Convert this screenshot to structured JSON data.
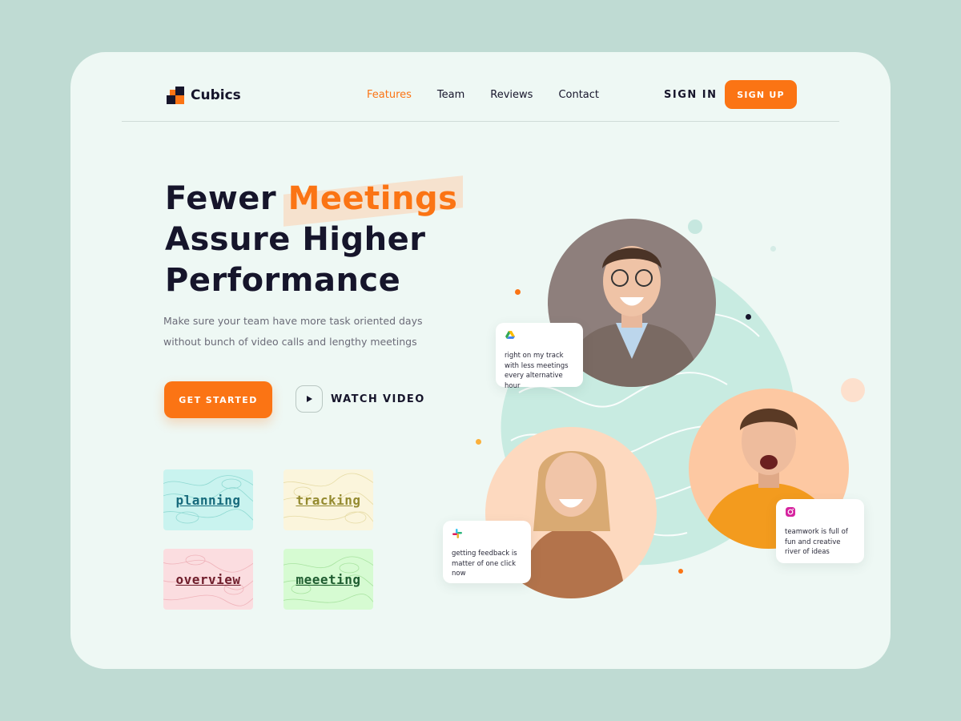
{
  "brand": {
    "name": "Cubics"
  },
  "nav": [
    {
      "label": "Features",
      "active": true
    },
    {
      "label": "Team",
      "active": false
    },
    {
      "label": "Reviews",
      "active": false
    },
    {
      "label": "Contact",
      "active": false
    }
  ],
  "auth": {
    "sign_in": "SIGN IN",
    "sign_up": "SIGN UP"
  },
  "hero": {
    "title_pre": "Fewer ",
    "title_highlight": "Meetings",
    "title_line2": "Assure Higher",
    "title_line3": "Performance",
    "subtitle": "Make sure your team have more task oriented days without bunch of video calls and lengthy meetings",
    "cta_primary": "GET STARTED",
    "cta_secondary": "WATCH VIDEO"
  },
  "tiles": [
    {
      "label": "planning"
    },
    {
      "label": "tracking"
    },
    {
      "label": "overview"
    },
    {
      "label": "meeeting"
    }
  ],
  "testimonials": [
    {
      "icon": "google-drive-icon",
      "text": "right on my track with less meetings every alternative hour"
    },
    {
      "icon": "slack-icon",
      "text": "getting feedback is matter of one click now"
    },
    {
      "icon": "instagram-icon",
      "text": "teamwork is full of fun and creative river of ideas"
    }
  ],
  "colors": {
    "accent": "#fb7414",
    "dark": "#16152b",
    "background": "#bfdbd3",
    "card": "#eef8f4"
  }
}
